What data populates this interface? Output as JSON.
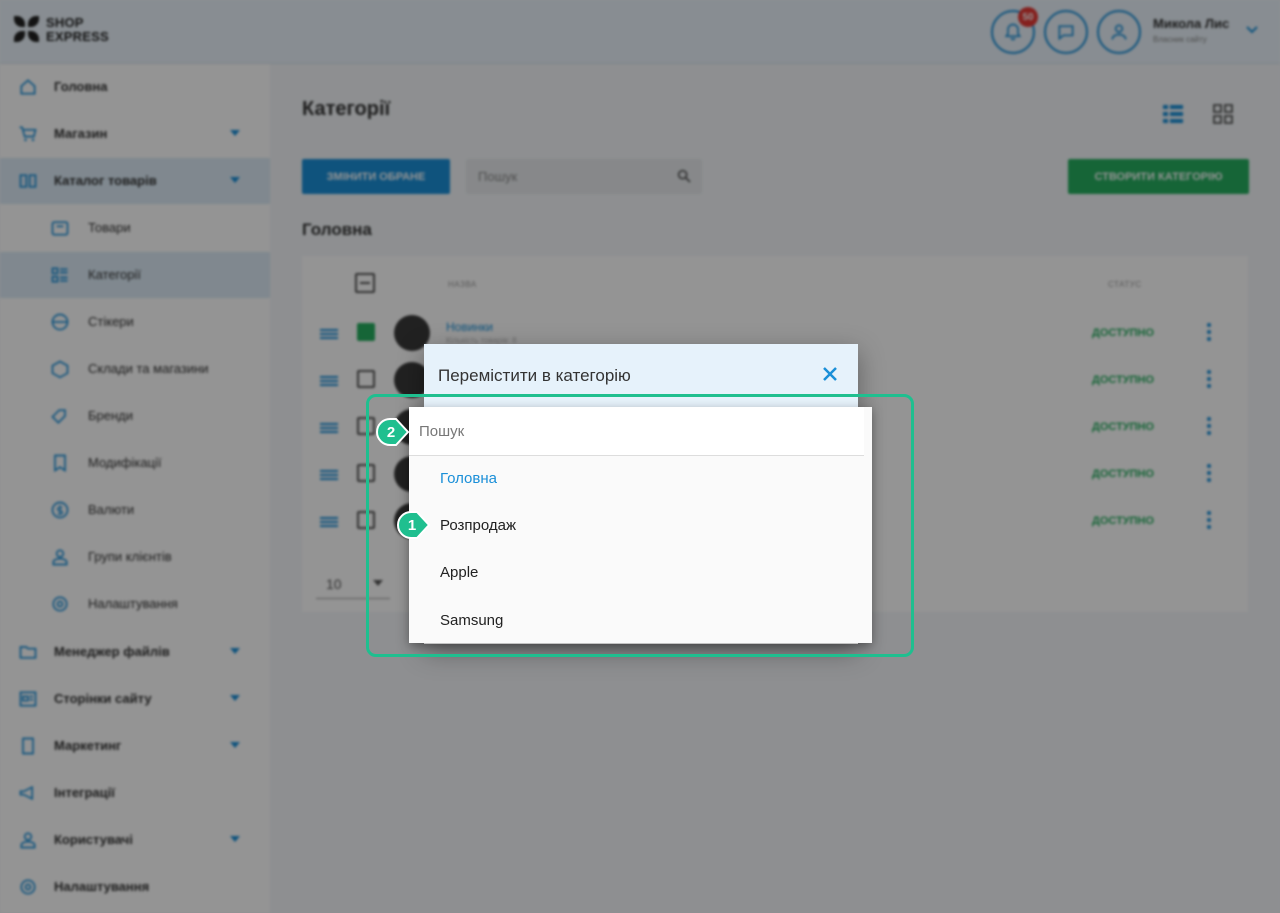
{
  "brand": {
    "line1": "SHOP",
    "line2": "EXPRESS"
  },
  "header": {
    "notifications_count": "50",
    "user_name": "Микола Лис",
    "user_role": "Власник сайту"
  },
  "sidebar": {
    "items": [
      {
        "label": "Головна",
        "icon": "home-icon"
      },
      {
        "label": "Магазин",
        "icon": "cart-icon"
      },
      {
        "label": "Каталог товарів",
        "icon": "catalog-icon"
      },
      {
        "label": "Товари",
        "icon": "box-icon"
      },
      {
        "label": "Категорії",
        "icon": "categories-icon"
      },
      {
        "label": "Стікери",
        "icon": "sticker-icon"
      },
      {
        "label": "Склади та магазини",
        "icon": "warehouse-icon"
      },
      {
        "label": "Бренди",
        "icon": "tag-icon"
      },
      {
        "label": "Модифікації",
        "icon": "bookmark-icon"
      },
      {
        "label": "Валюти",
        "icon": "currency-icon"
      },
      {
        "label": "Групи клієнтів",
        "icon": "users-icon"
      },
      {
        "label": "Налаштування",
        "icon": "gear-icon"
      },
      {
        "label": "Менеджер файлів",
        "icon": "folder-icon"
      },
      {
        "label": "Сторінки сайту",
        "icon": "pages-icon"
      },
      {
        "label": "Маркетинг",
        "icon": "marketing-icon"
      },
      {
        "label": "Інтеграції",
        "icon": "megaphone-icon"
      },
      {
        "label": "Користувачі",
        "icon": "user-icon"
      },
      {
        "label": "Налаштування",
        "icon": "gear-icon"
      }
    ]
  },
  "page": {
    "title": "Категорії",
    "edit_selected": "ЗМІНИТИ ОБРАНЕ",
    "search_placeholder": "Пошук",
    "create_button": "СТВОРИТИ КАТЕГОРІЮ",
    "section_title": "Головна"
  },
  "table": {
    "col_name": "НАЗВА",
    "col_status": "СТАТУС",
    "rows": [
      {
        "name": "Новинки",
        "sub": "Кількість товарів: 8",
        "status": "ДОСТУПНО",
        "checked": true
      },
      {
        "name": "",
        "sub": "",
        "status": "ДОСТУПНО",
        "checked": false
      },
      {
        "name": "",
        "sub": "",
        "status": "ДОСТУПНО",
        "checked": false
      },
      {
        "name": "",
        "sub": "",
        "status": "ДОСТУПНО",
        "checked": false
      },
      {
        "name": "",
        "sub": "",
        "status": "ДОСТУПНО",
        "checked": false
      }
    ],
    "per_page": "10"
  },
  "modal": {
    "title": "Перемістити в категорію",
    "search_placeholder": "Пошук",
    "options": [
      "Головна",
      "Розпродаж",
      "Apple",
      "Samsung"
    ],
    "selected": "Головна"
  },
  "markers": {
    "m1": "1",
    "m2": "2"
  },
  "colors": {
    "accent": "#1a8fd8",
    "success": "#27ae60",
    "highlight": "#1fbf8f",
    "badge": "#e53935"
  }
}
